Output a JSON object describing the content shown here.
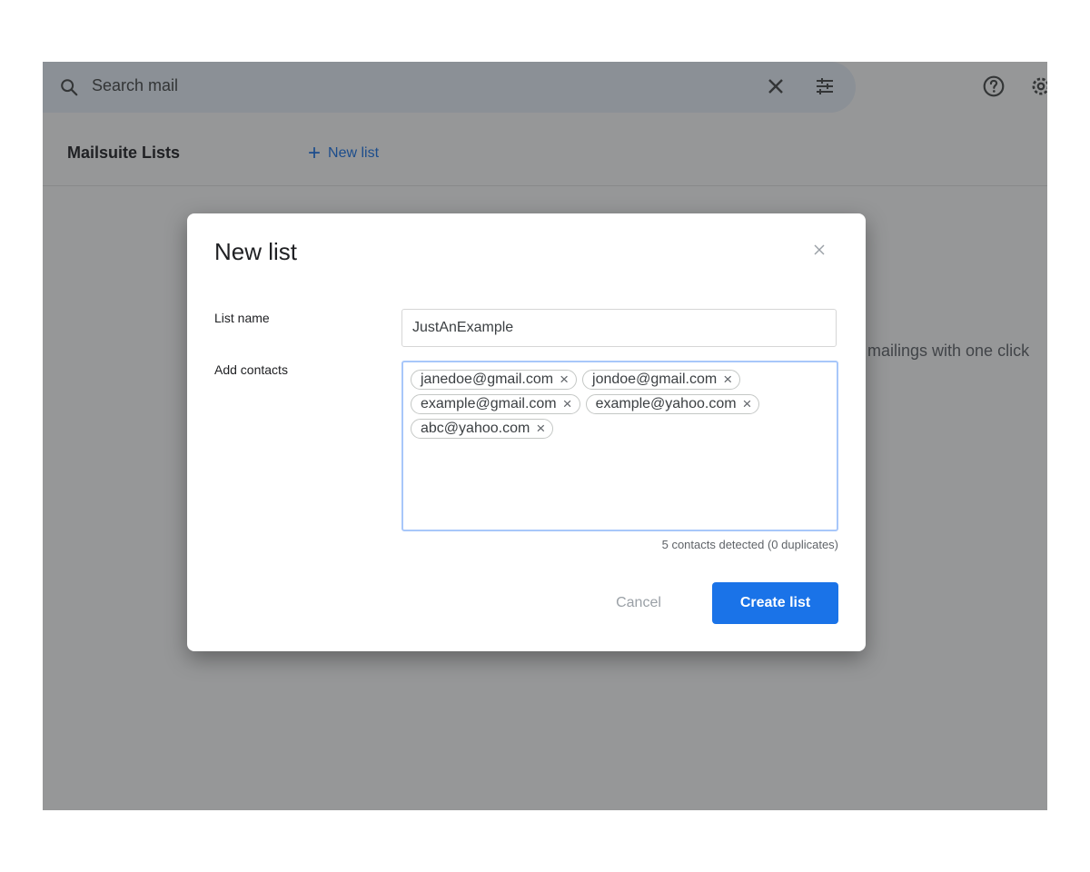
{
  "search": {
    "placeholder": "Search mail"
  },
  "toolbar": {
    "title": "Mailsuite Lists",
    "new_list_label": "New list"
  },
  "background": {
    "description_fragment": "mailings with one click"
  },
  "dialog": {
    "title": "New list",
    "list_name_label": "List name",
    "list_name_value": "JustAnExample",
    "add_contacts_label": "Add contacts",
    "contacts": [
      "janedoe@gmail.com",
      "jondoe@gmail.com",
      "example@gmail.com",
      "example@yahoo.com",
      "abc@yahoo.com"
    ],
    "detected_text": "5 contacts detected (0 duplicates)",
    "cancel_label": "Cancel",
    "create_label": "Create list"
  },
  "colors": {
    "accent": "#1a73e8",
    "overlay": "#8a8a8a",
    "search_background": "#eaf1fb",
    "focus_border": "#a8c7fa"
  },
  "icons": {
    "search": "search-icon",
    "clear": "close-icon",
    "filter": "tune-icon",
    "help": "help-icon",
    "settings": "gear-icon",
    "dialog_close": "close-icon",
    "chip_remove": "close-icon"
  }
}
